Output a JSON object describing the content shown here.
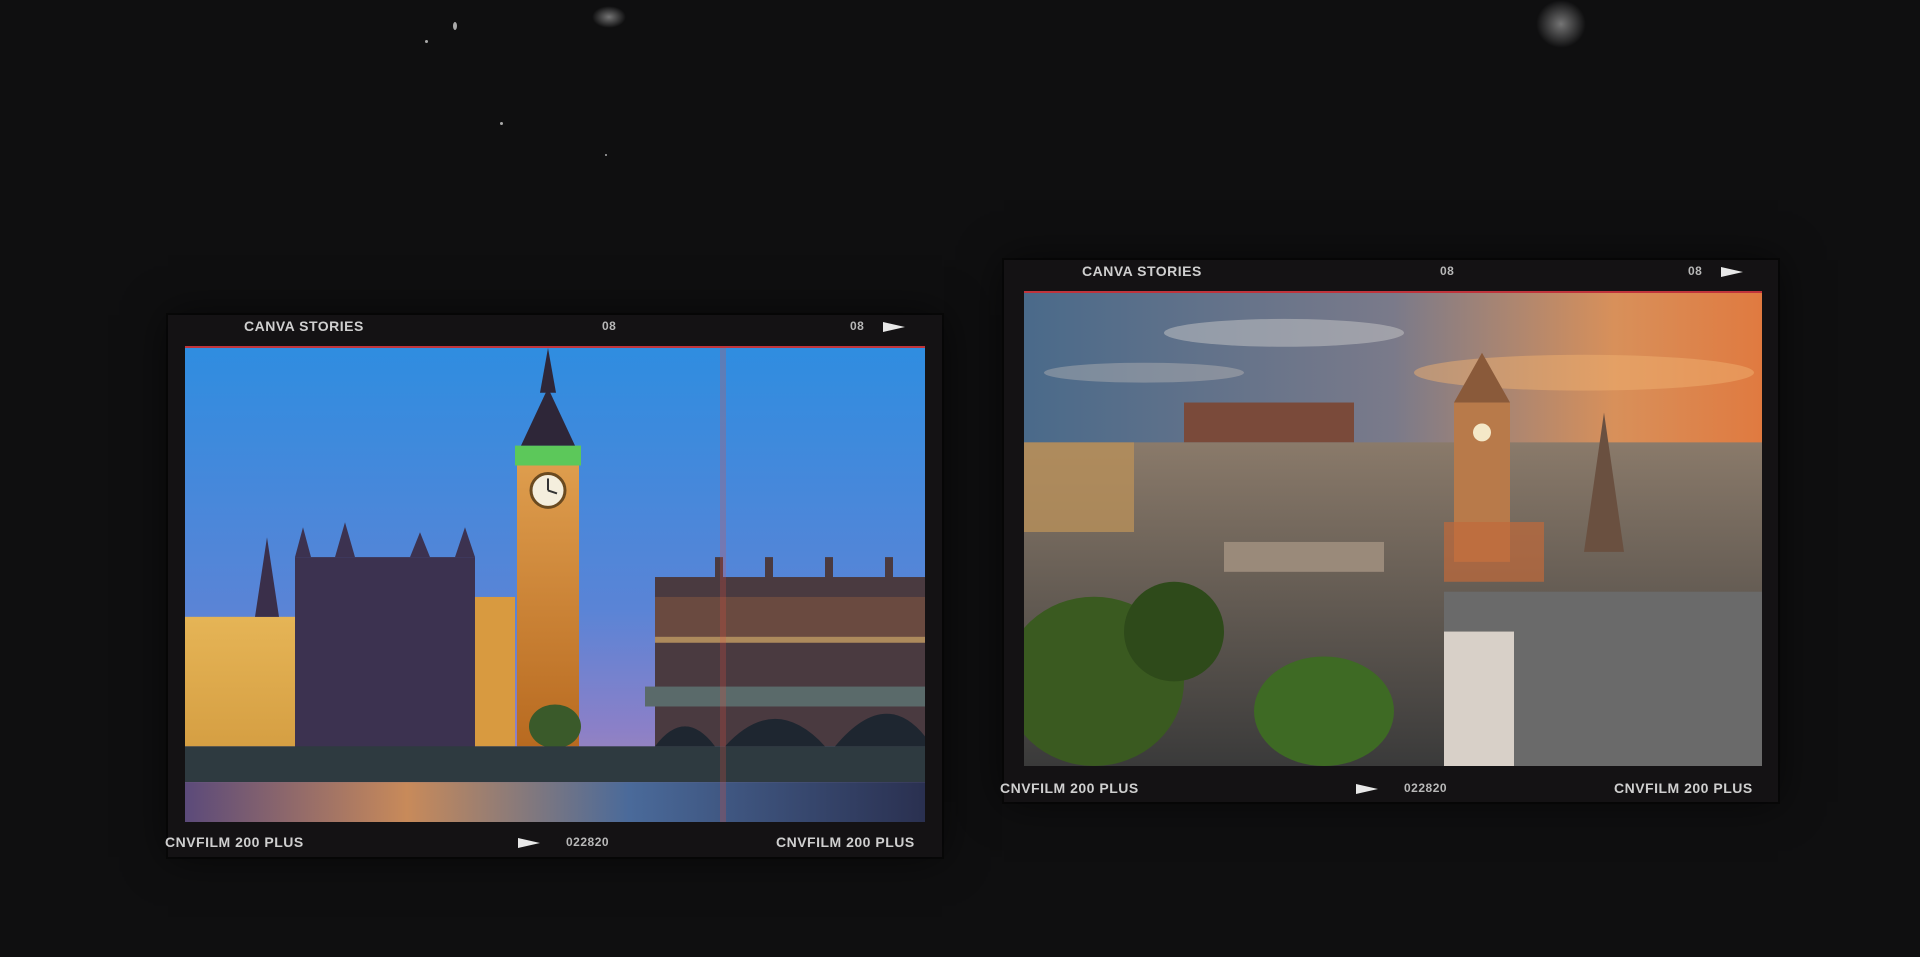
{
  "frames": [
    {
      "id": "london",
      "top_left_label": "CANVA STORIES",
      "top_mid_number": "08",
      "top_right_number": "08",
      "bottom_left_label": "CNVFILM 200 PLUS",
      "bottom_mid_number": "022820",
      "bottom_right_label": "CNVFILM 200 PLUS",
      "photo_icon": "big-ben-westminster-photo"
    },
    {
      "id": "edinburgh",
      "top_left_label": "CANVA STORIES",
      "top_mid_number": "08",
      "top_right_number": "08",
      "bottom_left_label": "CNVFILM 200 PLUS",
      "bottom_mid_number": "022820",
      "bottom_right_label": "CNVFILM 200 PLUS",
      "photo_icon": "edinburgh-skyline-photo"
    }
  ],
  "colors": {
    "background": "#0f0f10",
    "frame": "#141214",
    "label": "#cfcfcf",
    "edge_red": "#c0343c"
  }
}
